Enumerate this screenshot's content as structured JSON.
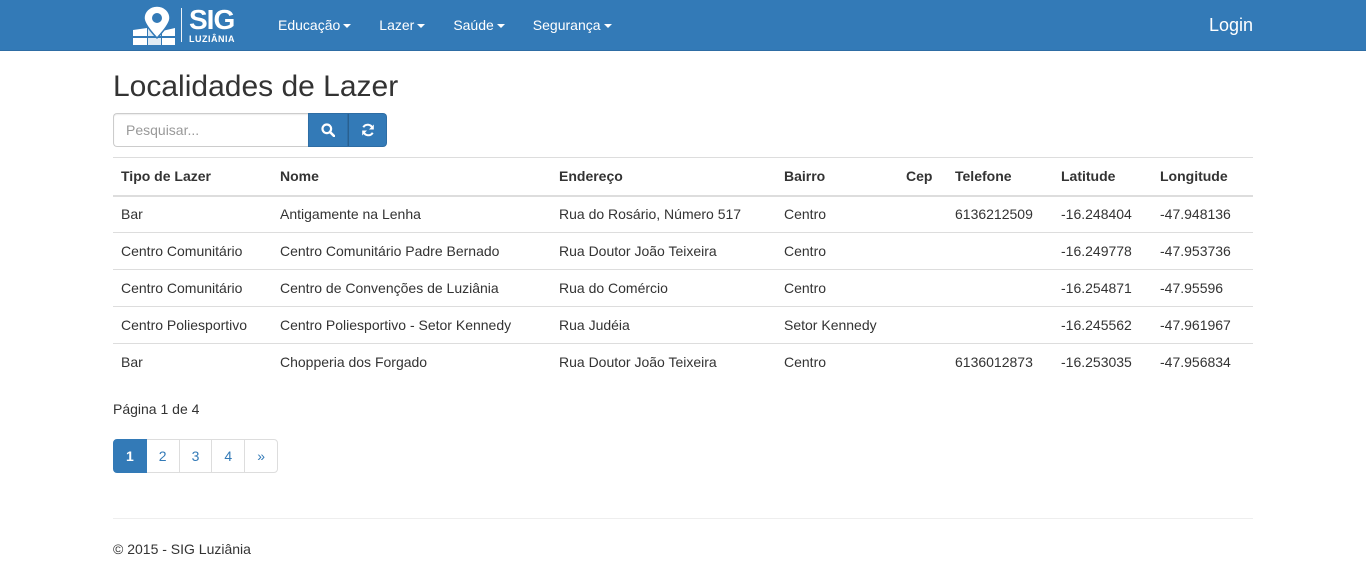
{
  "navbar": {
    "brand_title": "SIG",
    "brand_subtitle": "LUZIÂNIA",
    "menu": [
      {
        "label": "Educação"
      },
      {
        "label": "Lazer"
      },
      {
        "label": "Saúde"
      },
      {
        "label": "Segurança"
      }
    ],
    "login_label": "Login"
  },
  "page": {
    "title": "Localidades de Lazer"
  },
  "search": {
    "placeholder": "Pesquisar...",
    "search_icon": "search-icon",
    "refresh_icon": "refresh-icon"
  },
  "table": {
    "headers": [
      "Tipo de Lazer",
      "Nome",
      "Endereço",
      "Bairro",
      "Cep",
      "Telefone",
      "Latitude",
      "Longitude"
    ],
    "rows": [
      [
        "Bar",
        "Antigamente na Lenha",
        "Rua do Rosário, Número 517",
        "Centro",
        "",
        "6136212509",
        "-16.248404",
        "-47.948136"
      ],
      [
        "Centro Comunitário",
        "Centro Comunitário Padre Bernado",
        "Rua Doutor João Teixeira",
        "Centro",
        "",
        "",
        "-16.249778",
        "-47.953736"
      ],
      [
        "Centro Comunitário",
        "Centro de Convenções de Luziânia",
        "Rua do Comércio",
        "Centro",
        "",
        "",
        "-16.254871",
        "-47.95596"
      ],
      [
        "Centro Poliesportivo",
        "Centro Poliesportivo - Setor Kennedy",
        "Rua Judéia",
        "Setor Kennedy",
        "",
        "",
        "-16.245562",
        "-47.961967"
      ],
      [
        "Bar",
        "Chopperia dos Forgado",
        "Rua Doutor João Teixeira",
        "Centro",
        "",
        "6136012873",
        "-16.253035",
        "-47.956834"
      ]
    ]
  },
  "pagination": {
    "info": "Página 1 de 4",
    "pages": [
      "1",
      "2",
      "3",
      "4"
    ],
    "next_label": "»",
    "active": "1"
  },
  "footer": {
    "text": "© 2015 - SIG Luziânia"
  },
  "colors": {
    "primary": "#337ab7",
    "text": "#333333",
    "border": "#dddddd"
  }
}
